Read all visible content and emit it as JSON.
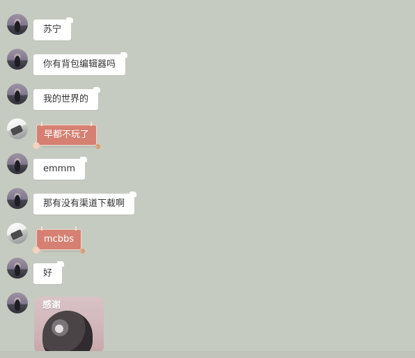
{
  "messages": [
    {
      "text": "苏宁"
    },
    {
      "text": "你有背包编辑器吗"
    },
    {
      "text": "我的世界的"
    },
    {
      "text": "早都不玩了"
    },
    {
      "text": "emmm"
    },
    {
      "text": "那有没有渠道下载啊"
    },
    {
      "text": "mcbbs"
    },
    {
      "text": "好"
    },
    {
      "text": "感谢"
    }
  ]
}
